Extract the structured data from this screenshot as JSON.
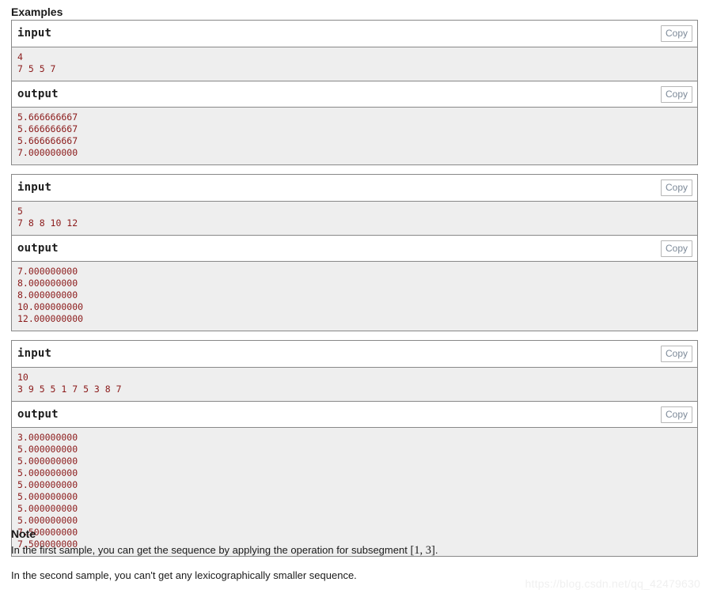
{
  "section": {
    "examples_title": "Examples",
    "note_title": "Note"
  },
  "copy_label": "Copy",
  "io_labels": {
    "input": "input",
    "output": "output"
  },
  "samples": [
    {
      "input_label": "input",
      "input_text": "4\n7 5 5 7",
      "output_label": "output",
      "output_text": "5.666666667\n5.666666667\n5.666666667\n7.000000000",
      "copy_input_label": "Copy",
      "copy_output_label": "Copy"
    },
    {
      "input_label": "input",
      "input_text": "5\n7 8 8 10 12",
      "output_label": "output",
      "output_text": "7.000000000\n8.000000000\n8.000000000\n10.000000000\n12.000000000",
      "copy_input_label": "Copy",
      "copy_output_label": "Copy"
    },
    {
      "input_label": "input",
      "input_text": "10\n3 9 5 5 1 7 5 3 8 7",
      "output_label": "output",
      "output_text": "3.000000000\n5.000000000\n5.000000000\n5.000000000\n5.000000000\n5.000000000\n5.000000000\n5.000000000\n7.500000000\n7.500000000",
      "copy_input_label": "Copy",
      "copy_output_label": "Copy"
    }
  ],
  "note": {
    "paragraph_1_before": "In the first sample, you can get the sequence by applying the operation for subsegment ",
    "paragraph_1_math": "[1, 3]",
    "paragraph_1_after": ".",
    "paragraph_2": "In the second sample, you can't get any lexicographically smaller sequence."
  },
  "watermark": {
    "text": "https://blog.csdn.net/qq_42479630"
  },
  "colors": {
    "data_text": "#8b1a1a",
    "data_background": "#eeeeee",
    "border": "#888888",
    "copy_text": "#7d8a99",
    "watermark": "#f0f0f0"
  }
}
